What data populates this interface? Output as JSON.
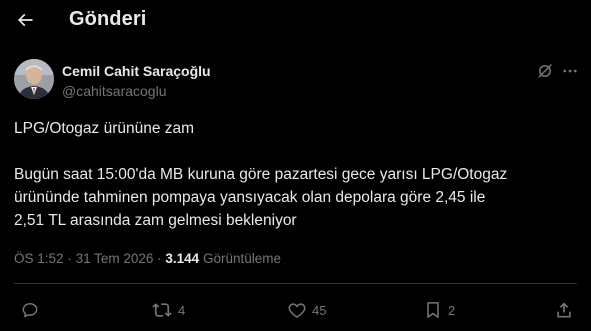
{
  "header": {
    "title": "Gönderi",
    "back_icon": "arrow-left-icon"
  },
  "tweet": {
    "author_name": "Cemil Cahit Saraçoğlu",
    "author_handle": "@cahitsaracoglu",
    "lines": [
      "LPG/Otogaz ürününe zam",
      "Bugün saat 15:00'da MB kuruna göre pazartesi gece yarısı LPG/Otogaz",
      "ürününde tahminen pompaya yansıyacak olan depolara göre 2,45 ile",
      "2,51 TL arasında zam gelmesi bekleniyor"
    ],
    "time": "ÖS 1:52",
    "separator": "·",
    "date": "31 Tem 2026",
    "views_count": "3.144",
    "views_label": "Görüntüleme"
  },
  "actions": {
    "reply_count": "",
    "retweet_count": "4",
    "like_count": "45",
    "bookmark_count": "2"
  },
  "icons": {
    "back": "arrow-left-icon",
    "grok": "grok-icon",
    "more": "more-horizontal-icon",
    "reply": "reply-icon",
    "retweet": "retweet-icon",
    "like": "heart-icon",
    "bookmark": "bookmark-icon",
    "share": "share-icon"
  },
  "colors": {
    "background": "#000000",
    "text_primary": "#e7e9ea",
    "text_secondary": "#71767b",
    "divider": "#2f3336"
  }
}
